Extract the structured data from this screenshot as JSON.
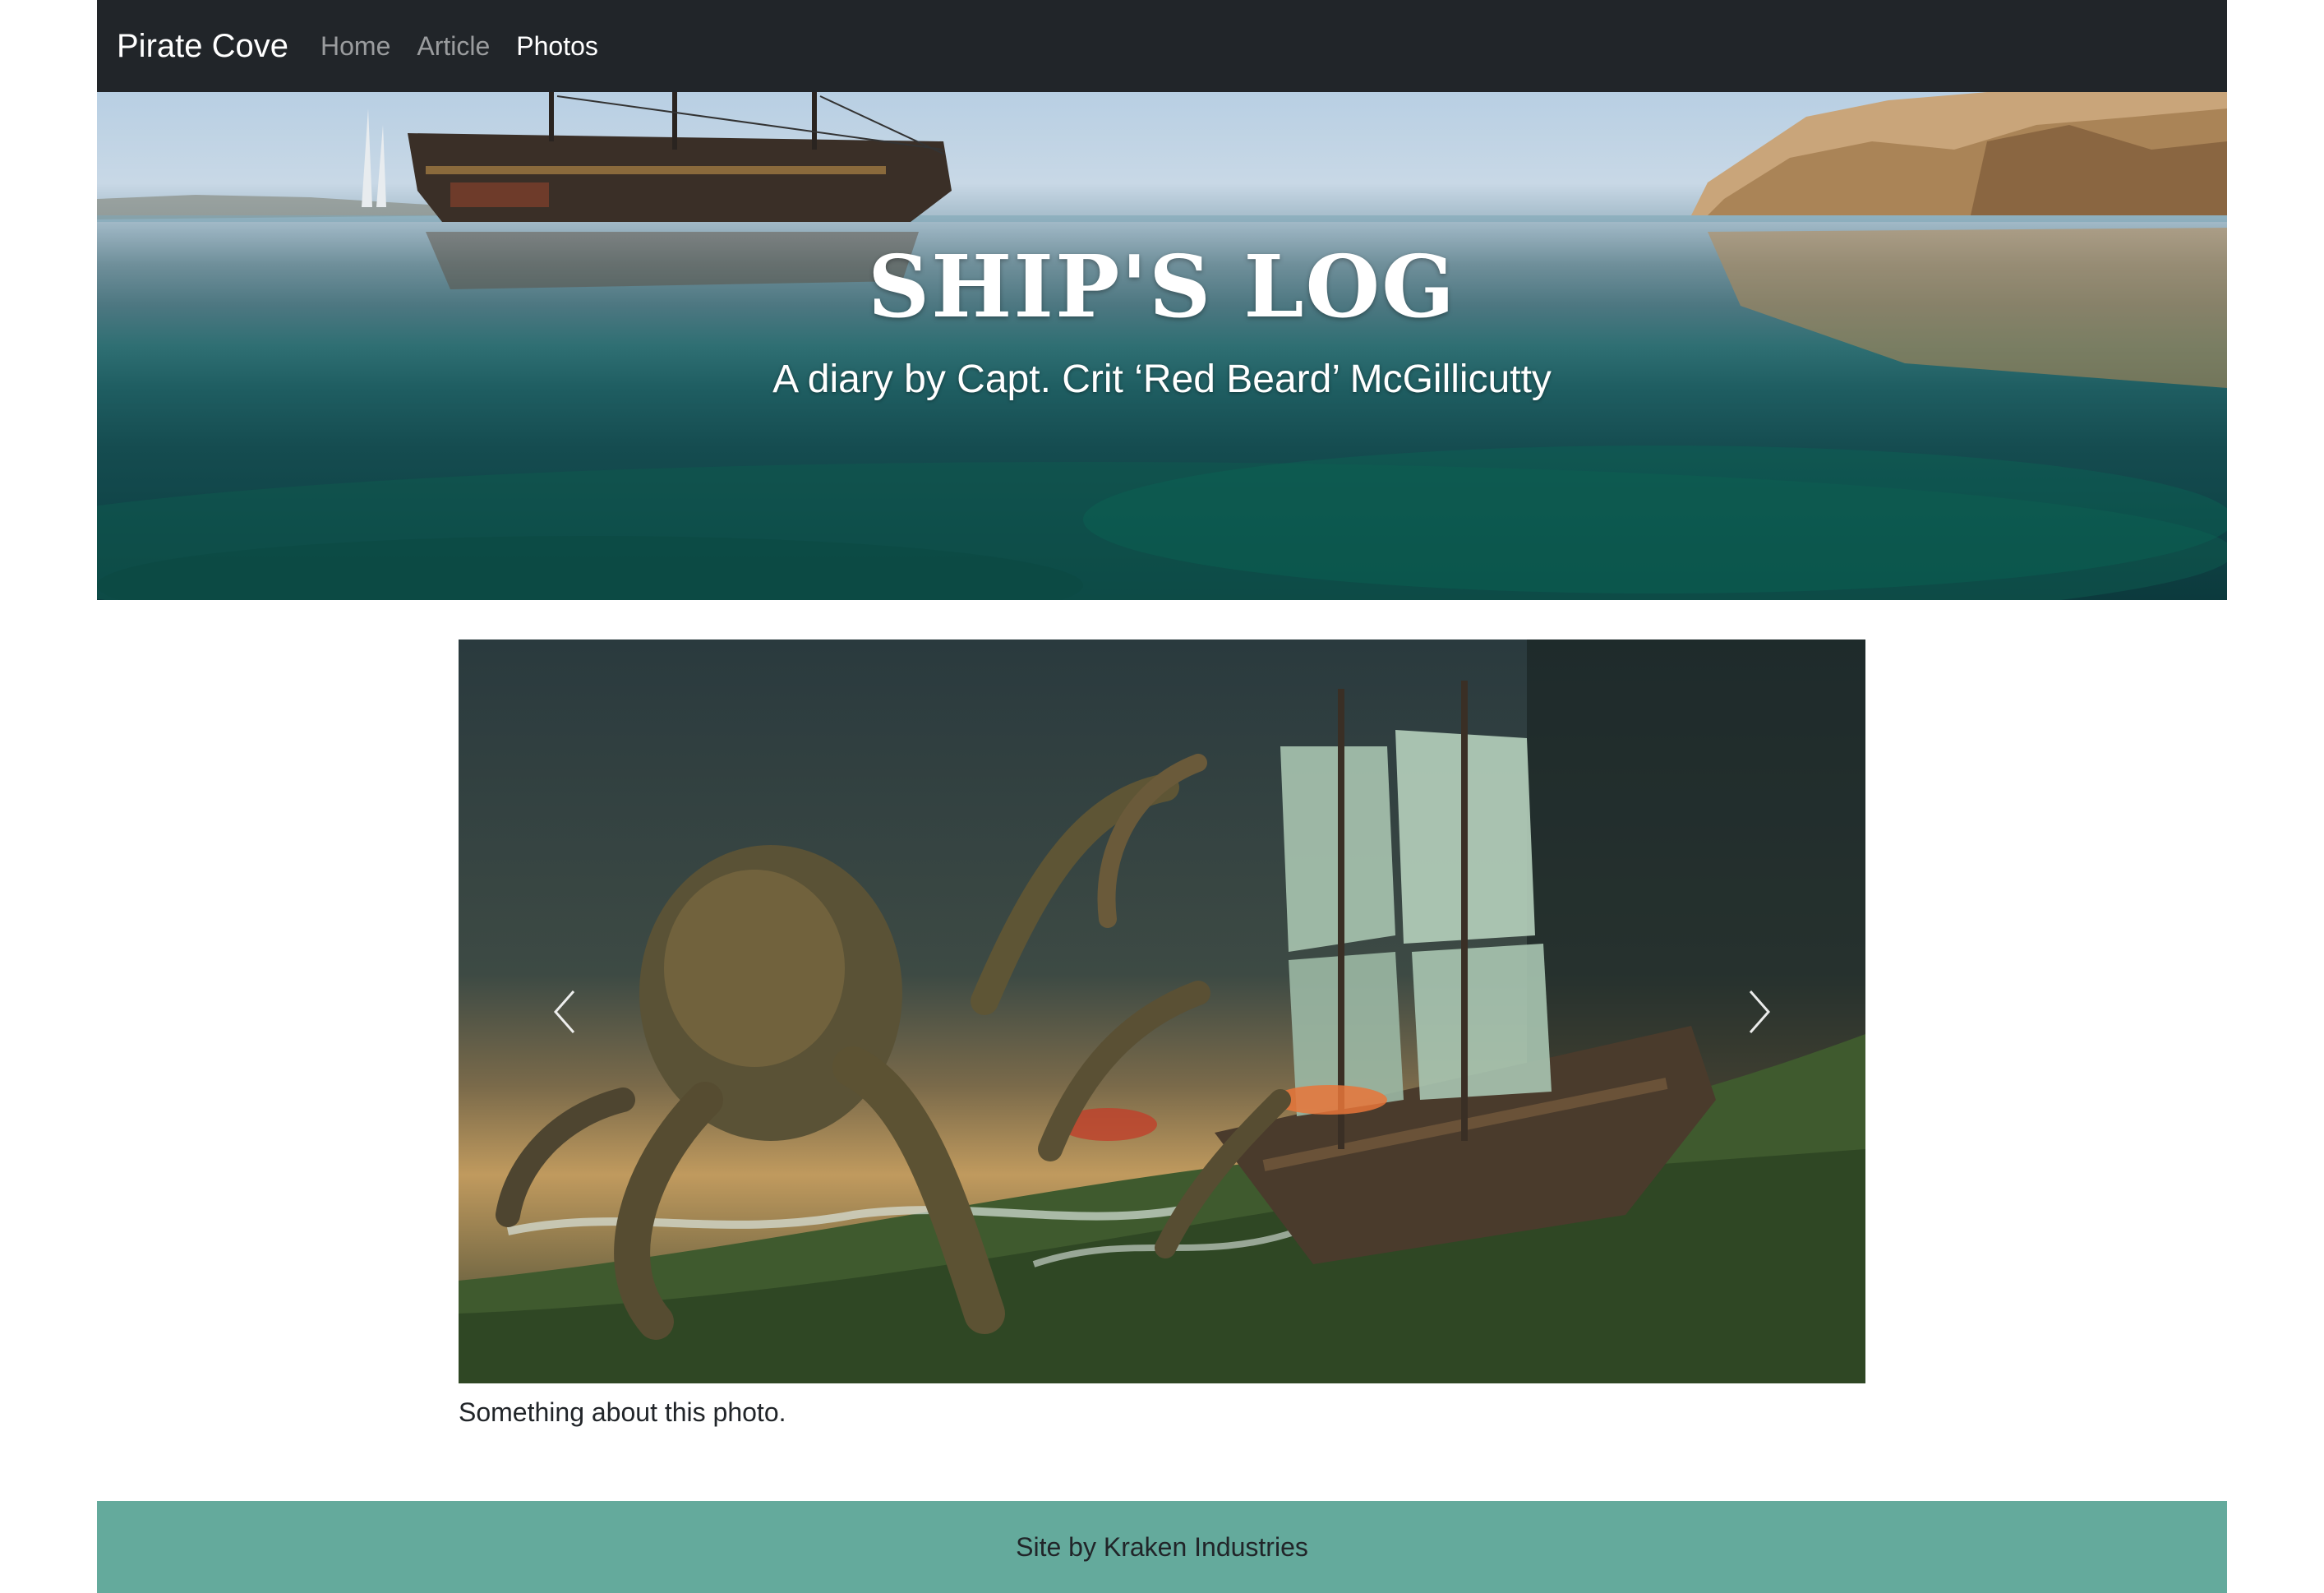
{
  "nav": {
    "brand": "Pirate Cove",
    "links": [
      {
        "label": "Home",
        "active": false
      },
      {
        "label": "Article",
        "active": false
      },
      {
        "label": "Photos",
        "active": true
      }
    ]
  },
  "hero": {
    "title": "SHIP'S LOG",
    "subtitle": "A diary by Capt. Crit ‘Red Beard’ McGillicutty"
  },
  "carousel": {
    "image_subject": "kraken attacking a sailing ship painting",
    "prev_icon": "chevron-left-icon",
    "next_icon": "chevron-right-icon",
    "caption": "Something about this photo."
  },
  "footer": {
    "text": "Site by Kraken Industries"
  },
  "colors": {
    "navbar": "#212529",
    "footer": "#64aa9c",
    "text": "#212529"
  }
}
